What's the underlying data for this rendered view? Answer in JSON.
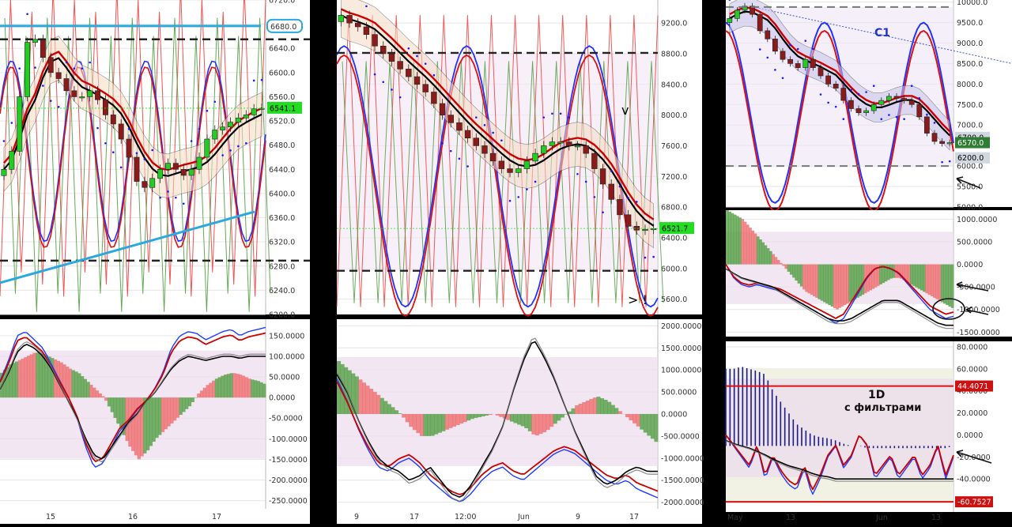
{
  "chart_data": [
    {
      "panel": "left-top",
      "type": "candlestick",
      "y_ticks": [
        "6720.0",
        "6680.0",
        "6640.0",
        "6600.0",
        "6560.0",
        "6520.0",
        "6480.0",
        "6440.0",
        "6400.0",
        "6360.0",
        "6320.0",
        "6280.0",
        "6240.0",
        "6200.0"
      ],
      "ylim": [
        6200,
        6720
      ],
      "price_label": "6541.1",
      "price_label_color": "#22dd22",
      "bubble_label": "6680.0",
      "x_ticks": [
        "15",
        "16",
        "17"
      ],
      "hlines": [
        6655,
        6289
      ],
      "trendline_top": 6677,
      "trendline_rising": [
        6285,
        6370
      ],
      "close": [
        6440,
        6470,
        6560,
        6650,
        6655,
        6625,
        6600,
        6590,
        6570,
        6560,
        6560,
        6570,
        6555,
        6530,
        6515,
        6490,
        6460,
        6420,
        6410,
        6425,
        6440,
        6450,
        6440,
        6430,
        6440,
        6460,
        6490,
        6505,
        6510,
        6518,
        6525,
        6530,
        6540,
        6541
      ]
    },
    {
      "panel": "left-bottom",
      "type": "oscillator",
      "y_ticks": [
        "150.0000",
        "100.0000",
        "50.0000",
        "0.0000",
        "-50.0000",
        "-100.0000",
        "-150.0000",
        "-200.0000",
        "-250.0000"
      ],
      "ylim": [
        -270,
        190
      ],
      "hist": [
        60,
        80,
        90,
        100,
        110,
        105,
        95,
        85,
        70,
        60,
        40,
        20,
        0,
        -40,
        -80,
        -120,
        -150,
        -130,
        -100,
        -80,
        -60,
        -40,
        -20,
        10,
        30,
        45,
        55,
        60,
        55,
        45,
        40,
        30
      ],
      "line_a": [
        40,
        90,
        150,
        160,
        140,
        120,
        80,
        40,
        0,
        -50,
        -120,
        -170,
        -160,
        -120,
        -80,
        -60,
        -30,
        -10,
        20,
        60,
        120,
        150,
        160,
        155,
        140,
        150,
        160,
        165,
        150,
        160,
        165,
        170
      ],
      "line_b": [
        20,
        60,
        110,
        130,
        120,
        100,
        70,
        30,
        -10,
        -50,
        -100,
        -140,
        -150,
        -120,
        -90,
        -60,
        -40,
        -10,
        10,
        40,
        70,
        90,
        100,
        95,
        90,
        95,
        100,
        100,
        95,
        100,
        100,
        100
      ]
    },
    {
      "panel": "middle-top",
      "type": "candlestick",
      "y_ticks": [
        "9200.0",
        "8800.0",
        "8400.0",
        "8000.0",
        "7600.0",
        "7200.0",
        "6800.0",
        "6400.0",
        "6000.0",
        "5600.0"
      ],
      "ylim": [
        5400,
        9500
      ],
      "price_label": "6521.7",
      "price_label_color": "#22dd22",
      "x_ticks": [
        "9",
        "17",
        "12:00",
        "Jun",
        "9",
        "17"
      ],
      "hlines": [
        8810,
        5970
      ],
      "annotations": [
        "v",
        "> !"
      ],
      "close": [
        9300,
        9200,
        9150,
        9050,
        8900,
        8800,
        8700,
        8600,
        8500,
        8400,
        8300,
        8150,
        8000,
        7900,
        7800,
        7700,
        7600,
        7500,
        7400,
        7300,
        7250,
        7300,
        7400,
        7500,
        7600,
        7650,
        7650,
        7600,
        7600,
        7500,
        7300,
        7100,
        6900,
        6700,
        6550,
        6500,
        6510,
        6520
      ]
    },
    {
      "panel": "middle-bottom",
      "type": "oscillator",
      "y_ticks": [
        "2000.0000",
        "1500.0000",
        "1000.0000",
        "500.0000",
        "0.0000",
        "-500.0000",
        "-1000.0000",
        "-1500.0000",
        "-2000.0000"
      ],
      "ylim": [
        -2150,
        2150
      ],
      "hist": [
        1200,
        1000,
        800,
        600,
        400,
        200,
        0,
        -300,
        -500,
        -500,
        -400,
        -300,
        -200,
        -100,
        -50,
        0,
        -100,
        -200,
        -300,
        -500,
        -400,
        -200,
        0,
        200,
        300,
        400,
        300,
        100,
        -100,
        -300,
        -500,
        -700
      ],
      "line_a": [
        800,
        300,
        -300,
        -800,
        -1200,
        -1300,
        -1100,
        -1000,
        -1200,
        -1500,
        -1700,
        -1900,
        -2000,
        -1800,
        -1500,
        -1300,
        -1200,
        -1400,
        -1500,
        -1300,
        -1100,
        -900,
        -800,
        -900,
        -1100,
        -1300,
        -1500,
        -1600,
        -1500,
        -1700,
        -1800,
        -1900
      ],
      "line_b": [
        900,
        500,
        -100,
        -600,
        -1000,
        -1200,
        -1300,
        -1500,
        -1400,
        -1200,
        -1500,
        -1800,
        -1900,
        -1600,
        -1200,
        -800,
        -300,
        500,
        1200,
        1700,
        1300,
        800,
        200,
        -400,
        -900,
        -1400,
        -1600,
        -1500,
        -1300,
        -1200,
        -1300,
        -1300
      ]
    },
    {
      "panel": "right-top",
      "type": "candlestick",
      "title": "C1",
      "y_ticks": [
        "10000.0",
        "9500.0",
        "9000.0",
        "8500.0",
        "8000.0",
        "7500.0",
        "7000.0",
        "6500.0",
        "6000.0",
        "5500.0",
        "5000.0"
      ],
      "ylim": [
        5000,
        10050
      ],
      "price_labels": [
        {
          "text": "6700.0",
          "value": 6700
        },
        {
          "text": "6570.0",
          "value": 6570
        },
        {
          "text": "6200.0",
          "value": 6200
        }
      ],
      "hlines": [
        9880,
        6000
      ],
      "close": [
        9600,
        9800,
        9900,
        9700,
        9300,
        9100,
        8800,
        8600,
        8500,
        8400,
        8600,
        8400,
        8200,
        8000,
        7900,
        7600,
        7400,
        7300,
        7350,
        7500,
        7600,
        7700,
        7650,
        7600,
        7500,
        7200,
        6800,
        6600,
        6550,
        6570
      ]
    },
    {
      "panel": "right-middle",
      "type": "oscillator",
      "y_ticks": [
        "1000.0000",
        "500.0000",
        "0.0000",
        "-500.0000",
        "-1000.0000",
        "-1500.0000"
      ],
      "ylim": [
        -1600,
        1200
      ],
      "hist": [
        1200,
        1100,
        1000,
        800,
        600,
        400,
        200,
        0,
        -200,
        -400,
        -600,
        -700,
        -800,
        -900,
        -1000,
        -900,
        -800,
        -700,
        -600,
        -500,
        -400,
        -300,
        -300,
        -400,
        -500,
        -600,
        -700,
        -800,
        -900,
        -1000
      ],
      "line_a": [
        0,
        -300,
        -450,
        -500,
        -450,
        -500,
        -550,
        -600,
        -700,
        -800,
        -900,
        -1000,
        -1100,
        -1200,
        -1300,
        -1200,
        -900,
        -600,
        -300,
        -100,
        -50,
        -100,
        -200,
        -400,
        -600,
        -800,
        -1000,
        -1100,
        -1200,
        -1150
      ],
      "line_b": [
        -100,
        -200,
        -300,
        -350,
        -400,
        -450,
        -500,
        -600,
        -700,
        -800,
        -900,
        -1000,
        -1100,
        -1200,
        -1250,
        -1250,
        -1200,
        -1100,
        -1000,
        -900,
        -800,
        -800,
        -800,
        -900,
        -1000,
        -1100,
        -1200,
        -1300,
        -1350,
        -1350
      ]
    },
    {
      "panel": "right-bottom",
      "type": "oscillator",
      "title": "1D",
      "subtitle": "с фильтрами",
      "y_ticks": [
        "80.0000",
        "60.0000",
        "40.0000",
        "20.0000",
        "0.0000",
        "-20.0000",
        "-40.0000",
        "-60.0000"
      ],
      "ylim": [
        -70,
        85
      ],
      "level_labels": [
        {
          "text": "44.4071",
          "value": 44.4071
        },
        {
          "text": "-60.7527",
          "value": -60.7527
        }
      ],
      "x_ticks": [
        "May",
        "13",
        "Jun",
        "13"
      ],
      "bars": [
        60,
        60,
        62,
        60,
        58,
        55,
        40,
        30,
        20,
        10,
        5,
        0,
        -2,
        -3,
        -5,
        -8,
        -10,
        -10,
        -12,
        -12,
        -12,
        -12,
        -12,
        -12,
        -12,
        -12,
        -12,
        -12,
        -12,
        -10
      ],
      "line_a": [
        0,
        -10,
        -20,
        -30,
        -10,
        -40,
        -20,
        -35,
        -45,
        -50,
        -30,
        -55,
        -40,
        -20,
        -10,
        -30,
        -20,
        0,
        -10,
        -40,
        -30,
        -20,
        -40,
        -30,
        -20,
        -40,
        -30,
        -10,
        -40,
        -20
      ],
      "line_b": [
        -5,
        -8,
        -10,
        -12,
        -15,
        -18,
        -22,
        -25,
        -28,
        -30,
        -32,
        -35,
        -37,
        -38,
        -40,
        -40,
        -40,
        -40,
        -40,
        -40,
        -40,
        -40,
        -40,
        -40,
        -40,
        -40,
        -40,
        -40,
        -40,
        -40
      ]
    }
  ]
}
